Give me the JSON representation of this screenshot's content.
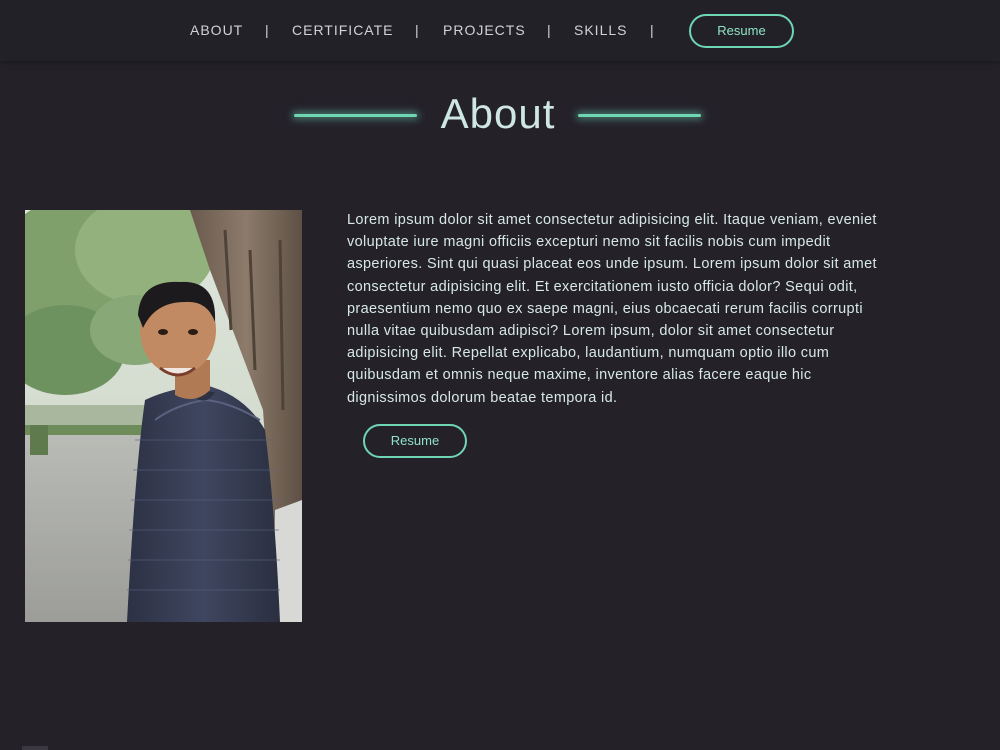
{
  "nav": {
    "links": [
      {
        "label": "ABOUT"
      },
      {
        "label": "CERTIFICATE"
      },
      {
        "label": "PROJECTS"
      },
      {
        "label": "SKILLS"
      }
    ],
    "separator": "|",
    "resume_label": "Resume"
  },
  "about": {
    "title": "About",
    "paragraph": "Lorem ipsum dolor sit amet consectetur adipisicing elit. Itaque veniam, eveniet voluptate iure magni officiis excepturi nemo sit facilis nobis cum impedit asperiores. Sint qui quasi placeat eos unde ipsum. Lorem ipsum dolor sit amet consectetur adipisicing elit. Et exercitationem iusto officia dolor? Sequi odit, praesentium nemo quo ex saepe magni, eius obcaecati rerum facilis corrupti nulla vitae quibusdam adipisci? Lorem ipsum, dolor sit amet consectetur adipisicing elit. Repellat explicabo, laudantium, numquam optio illo cum quibusdam et omnis neque maxime, inventore alias facere eaque hic dignissimos dolorum beatae tempora id.",
    "resume_label": "Resume"
  },
  "theme": {
    "background": "#242129",
    "accent": "#6fd6b4",
    "text": "#d6e8e4"
  }
}
